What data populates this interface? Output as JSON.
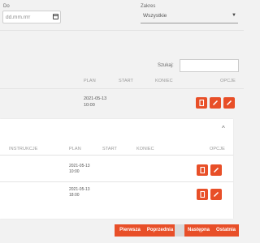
{
  "filters": {
    "do_label": "Do",
    "date_placeholder": "dd.mm.rrrr",
    "zakres_label": "Zakres",
    "zakres_value": "Wszystkie"
  },
  "search": {
    "label": "Szukaj:"
  },
  "table1": {
    "headers": {
      "plan": "PLAN",
      "start": "START",
      "koniec": "KONIEC",
      "opcje": "OPCJE"
    },
    "rows": [
      {
        "plan_date": "2021-05-13",
        "plan_time": "10:00"
      }
    ]
  },
  "table2": {
    "headers": {
      "instrukcje": "INSTRUKCJE",
      "plan": "PLAN",
      "start": "START",
      "koniec": "KONIEC",
      "opcje": "OPCJE"
    },
    "rows": [
      {
        "plan_date": "2021-05-13",
        "plan_time": "10:00"
      },
      {
        "plan_date": "2021-05-13",
        "plan_time": "18:00"
      }
    ]
  },
  "pagination": {
    "first": "Pierwsza",
    "prev": "Poprzednia",
    "next": "Następna",
    "last": "Ostatnia"
  },
  "colors": {
    "accent": "#e84f28"
  },
  "icons": [
    "calendar-icon",
    "chevron-down-icon",
    "copy-icon",
    "pencil-icon",
    "chevron-up-icon"
  ]
}
